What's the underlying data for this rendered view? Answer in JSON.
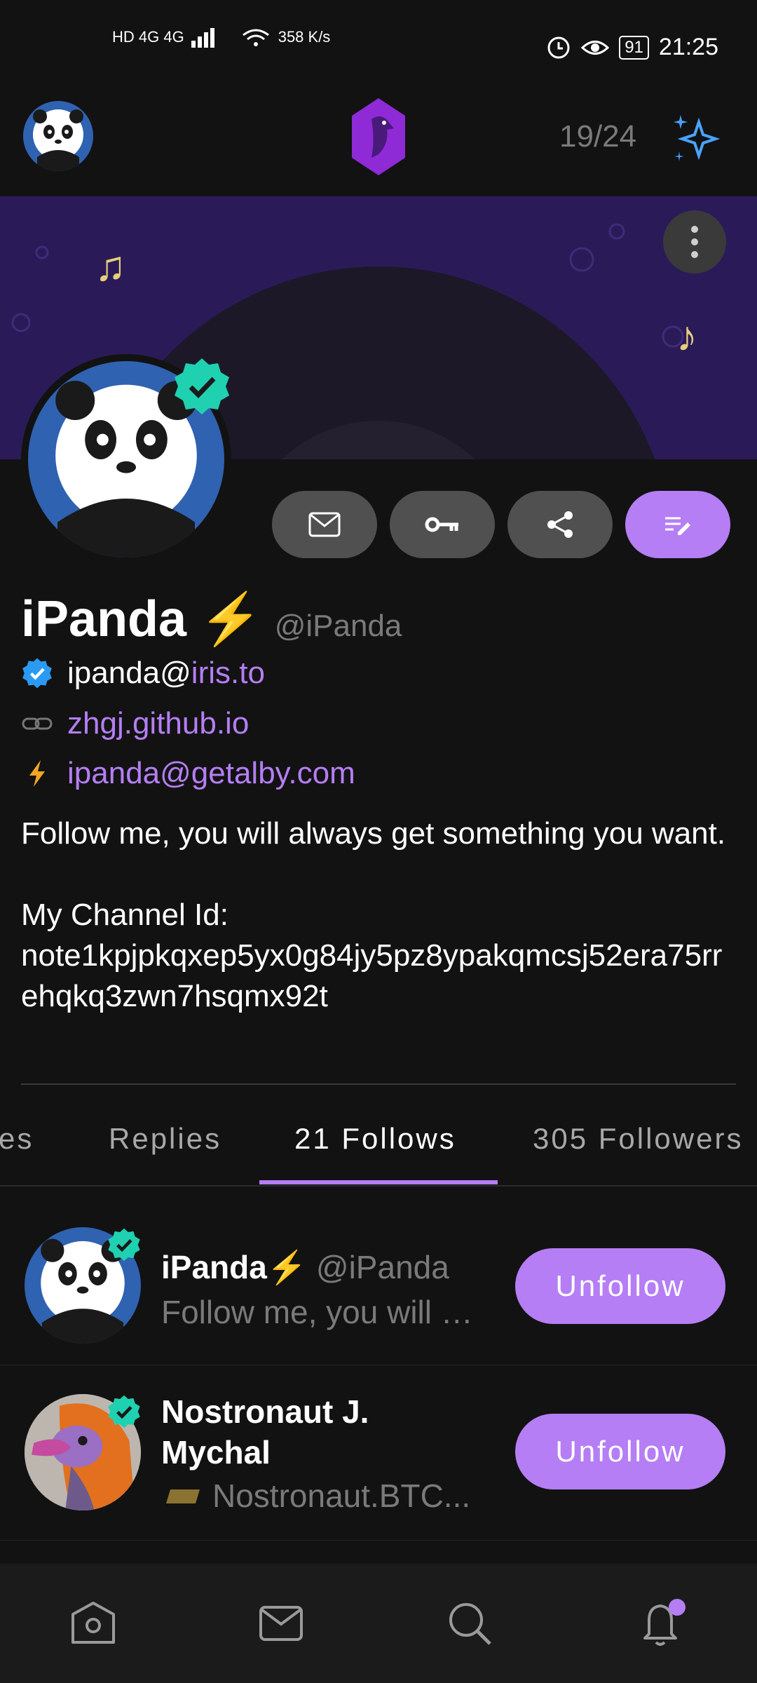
{
  "status_bar": {
    "network": "HD 4G 4G",
    "speed": "358 K/s",
    "battery": "91",
    "time": "21:25"
  },
  "top_bar": {
    "counter": "19/24"
  },
  "profile": {
    "name": "iPanda",
    "name_emoji": "⚡",
    "handle": "@iPanda",
    "nip05_user": "ipanda@",
    "nip05_domain": "iris.to",
    "website": "zhgj.github.io",
    "lightning": "ipanda@getalby.com",
    "bio": "Follow me, you will always get something you want.\n\nMy Channel Id:\nnote1kpjpkqxep5yx0g84jy5pz8ypakqmcsj52era75rrehqkq3zwn7hsqmx92t"
  },
  "tabs": [
    {
      "label": "es"
    },
    {
      "label": "Replies"
    },
    {
      "label": "21 Follows"
    },
    {
      "label": "305  Followers"
    }
  ],
  "follows": [
    {
      "name": "iPanda",
      "name_emoji": "⚡",
      "handle": "@iPanda",
      "sub": "Follow me, you will always get something you want.",
      "button": "Unfollow"
    },
    {
      "name_line1": "Nostronaut J.",
      "name_line2": "Mychal",
      "sub": "Nostronaut.BTC...",
      "button": "Unfollow"
    }
  ],
  "colors": {
    "accent": "#b57ef5",
    "verified": "#1fd1b0",
    "background": "#121212"
  },
  "icons": [
    "home-icon",
    "mail-icon",
    "search-icon",
    "bell-icon"
  ]
}
